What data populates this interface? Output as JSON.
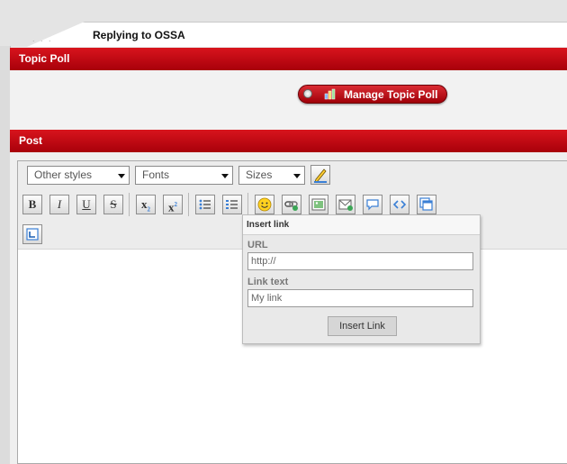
{
  "tab": {
    "title": "Replying to OSSA",
    "dots": ". . ."
  },
  "topic_poll": {
    "heading": "Topic Poll",
    "manage_button": "Manage Topic Poll"
  },
  "post": {
    "heading": "Post"
  },
  "toolbar": {
    "selects": [
      {
        "name": "other-styles",
        "value": "Other styles"
      },
      {
        "name": "fonts",
        "value": "Fonts"
      },
      {
        "name": "sizes",
        "value": "Sizes"
      }
    ],
    "buttons": {
      "bold": "B",
      "italic": "I",
      "underline": "U",
      "strikethrough": "S",
      "subscript": "x",
      "superscript": "x"
    }
  },
  "insert_link": {
    "title": "Insert link",
    "url_label": "URL",
    "url_value": "http://",
    "link_text_label": "Link text",
    "link_text_value": "My link",
    "submit": "Insert Link"
  },
  "colors": {
    "section_bar": "#c8000f",
    "accent": "#1a5fb4"
  }
}
